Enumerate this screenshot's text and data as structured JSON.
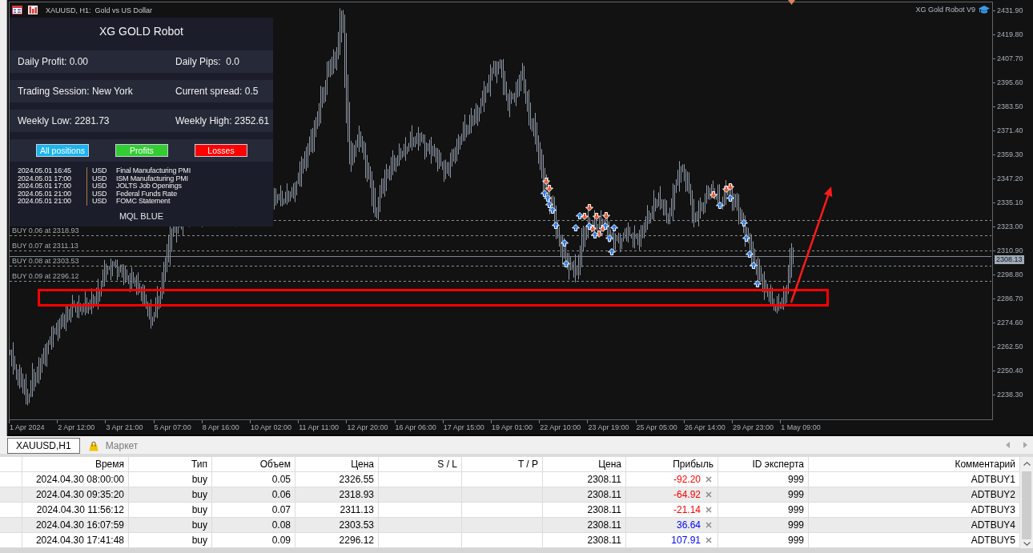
{
  "chart": {
    "title": "XAUUSD, H1:  Gold vs US Dollar",
    "robot_label": "XG Gold Robot V9",
    "order_labels": [
      "BUY 0.06 at 2318.93",
      "BUY 0.07 at 2311.13",
      "BUY 0.08 at 2303.53",
      "BUY 0.09 at 2296.12"
    ],
    "price_labels": [
      "2431.90",
      "2419.80",
      "2407.70",
      "2395.60",
      "2383.50",
      "2371.40",
      "2359.30",
      "2347.20",
      "2335.10",
      "2323.00",
      "2310.90",
      "2298.80",
      "2286.70",
      "2274.60",
      "2262.50",
      "2250.40",
      "2238.30"
    ],
    "current_price": "2308.13",
    "time_labels": [
      "1 Apr 2024",
      "2 Apr 12:00",
      "3 Apr 21:00",
      "5 Apr 07:00",
      "8 Apr 16:00",
      "10 Apr 02:00",
      "11 Apr 11:00",
      "12 Apr 20:00",
      "16 Apr 06:00",
      "17 Apr 15:00",
      "19 Apr 01:00",
      "22 Apr 10:00",
      "23 Apr 19:00",
      "25 Apr 05:00",
      "26 Apr 14:00",
      "29 Apr 23:00",
      "1 May 09:00"
    ]
  },
  "dashboard": {
    "title": "XG GOLD Robot",
    "stats": [
      {
        "left": "Daily Profit: 0.00",
        "right": "Daily Pips:  0.0"
      },
      {
        "left": "Trading Session: New York",
        "right": "Current spread: 0.5"
      },
      {
        "left": "Weekly Low: 2281.73",
        "right": "Weekly High: 2352.61"
      }
    ],
    "buttons": [
      {
        "label": "All positions",
        "color": "#1ab4ee"
      },
      {
        "label": "Profits",
        "color": "#33cc33"
      },
      {
        "label": "Losses",
        "color": "#ff0000"
      }
    ],
    "news": [
      {
        "time": "2024.05.01 16:45",
        "currency": "USD",
        "event": "Final Manufacturing PMI"
      },
      {
        "time": "2024.05.01 17:00",
        "currency": "USD",
        "event": "ISM Manufacturing PMI"
      },
      {
        "time": "2024.05.01 17:00",
        "currency": "USD",
        "event": "JOLTS Job Openings"
      },
      {
        "time": "2024.05.01 21:00",
        "currency": "USD",
        "event": "Federal Funds Rate"
      },
      {
        "time": "2024.05.01 21:00",
        "currency": "USD",
        "event": "FOMC Statement"
      }
    ],
    "footer": "MQL BLUE"
  },
  "tabs": [
    {
      "label": "XAUUSD,H1",
      "kind": "chart",
      "selected": true
    },
    {
      "label": "Маркет",
      "kind": "market",
      "selected": false
    }
  ],
  "positions": {
    "columns": [
      "Время",
      "Тип",
      "Объем",
      "Цена",
      "S / L",
      "T / P",
      "Цена",
      "Прибыль",
      "ID эксперта",
      "Комментарий"
    ],
    "rows": [
      {
        "time": "2024.04.30 08:00:00",
        "type": "buy",
        "volume": "0.05",
        "price": "2326.55",
        "current_price": "2308.11",
        "profit": "-92.20",
        "color": "#ff0000",
        "expert_id": "999",
        "comment": "ADTBUY1"
      },
      {
        "time": "2024.04.30 09:35:20",
        "type": "buy",
        "volume": "0.06",
        "price": "2318.93",
        "current_price": "2308.11",
        "profit": "-64.92",
        "color": "#ff0000",
        "expert_id": "999",
        "comment": "ADTBUY2"
      },
      {
        "time": "2024.04.30 11:56:12",
        "type": "buy",
        "volume": "0.07",
        "price": "2311.13",
        "current_price": "2308.11",
        "profit": "-21.14",
        "color": "#ff0000",
        "expert_id": "999",
        "comment": "ADTBUY3"
      },
      {
        "time": "2024.04.30 16:07:59",
        "type": "buy",
        "volume": "0.08",
        "price": "2303.53",
        "current_price": "2308.11",
        "profit": "36.64",
        "color": "#0000ff",
        "expert_id": "999",
        "comment": "ADTBUY4"
      },
      {
        "time": "2024.04.30 17:41:48",
        "type": "buy",
        "volume": "0.09",
        "price": "2296.12",
        "current_price": "2308.11",
        "profit": "107.91",
        "color": "#0000ff",
        "expert_id": "999",
        "comment": "ADTBUY5"
      }
    ]
  }
}
